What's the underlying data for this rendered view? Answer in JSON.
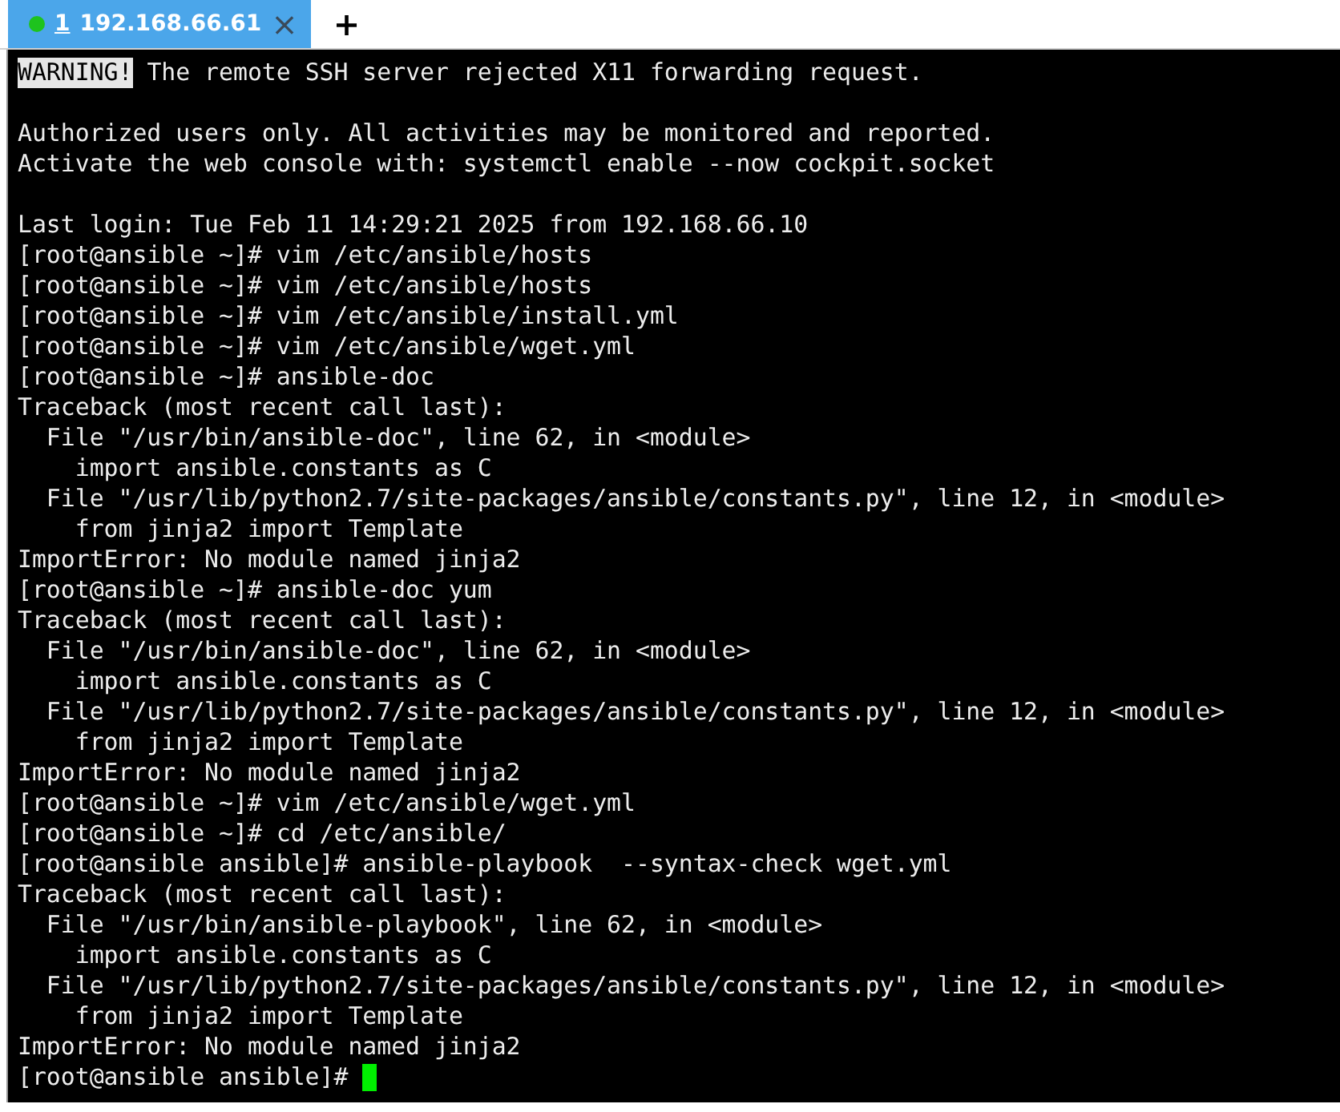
{
  "tabs": [
    {
      "index": "1",
      "title": "192.168.66.61",
      "close": "×",
      "selected": true,
      "color": "#1ec31e"
    }
  ],
  "new_tab": "+",
  "lines": [
    {
      "kind": "text",
      "badge": "WARNING!",
      "text": " The remote SSH server rejected X11 forwarding request."
    },
    {
      "kind": "blank"
    },
    {
      "kind": "text",
      "text": "Authorized users only. All activities may be monitored and reported."
    },
    {
      "kind": "text",
      "text": "Activate the web console with: systemctl enable --now cockpit.socket"
    },
    {
      "kind": "blank"
    },
    {
      "kind": "text",
      "text": "Last login: Tue Feb 11 14:29:21 2025 from 192.168.66.10"
    },
    {
      "kind": "text",
      "text": "[root@ansible ~]# vim /etc/ansible/hosts"
    },
    {
      "kind": "text",
      "text": "[root@ansible ~]# vim /etc/ansible/hosts"
    },
    {
      "kind": "text",
      "text": "[root@ansible ~]# vim /etc/ansible/install.yml"
    },
    {
      "kind": "text",
      "text": "[root@ansible ~]# vim /etc/ansible/wget.yml"
    },
    {
      "kind": "text",
      "text": "[root@ansible ~]# ansible-doc"
    },
    {
      "kind": "text",
      "text": "Traceback (most recent call last):"
    },
    {
      "kind": "text",
      "text": "  File \"/usr/bin/ansible-doc\", line 62, in <module>"
    },
    {
      "kind": "text",
      "text": "    import ansible.constants as C"
    },
    {
      "kind": "text",
      "text": "  File \"/usr/lib/python2.7/site-packages/ansible/constants.py\", line 12, in <module>"
    },
    {
      "kind": "text",
      "text": "    from jinja2 import Template"
    },
    {
      "kind": "text",
      "text": "ImportError: No module named jinja2"
    },
    {
      "kind": "text",
      "text": "[root@ansible ~]# ansible-doc yum"
    },
    {
      "kind": "text",
      "text": "Traceback (most recent call last):"
    },
    {
      "kind": "text",
      "text": "  File \"/usr/bin/ansible-doc\", line 62, in <module>"
    },
    {
      "kind": "text",
      "text": "    import ansible.constants as C"
    },
    {
      "kind": "text",
      "text": "  File \"/usr/lib/python2.7/site-packages/ansible/constants.py\", line 12, in <module>"
    },
    {
      "kind": "text",
      "text": "    from jinja2 import Template"
    },
    {
      "kind": "text",
      "text": "ImportError: No module named jinja2"
    },
    {
      "kind": "text",
      "text": "[root@ansible ~]# vim /etc/ansible/wget.yml"
    },
    {
      "kind": "text",
      "text": "[root@ansible ~]# cd /etc/ansible/"
    },
    {
      "kind": "text",
      "text": "[root@ansible ansible]# ansible-playbook  --syntax-check wget.yml"
    },
    {
      "kind": "text",
      "text": "Traceback (most recent call last):"
    },
    {
      "kind": "text",
      "text": "  File \"/usr/bin/ansible-playbook\", line 62, in <module>"
    },
    {
      "kind": "text",
      "text": "    import ansible.constants as C"
    },
    {
      "kind": "text",
      "text": "  File \"/usr/lib/python2.7/site-packages/ansible/constants.py\", line 12, in <module>"
    },
    {
      "kind": "text",
      "text": "    from jinja2 import Template"
    },
    {
      "kind": "text",
      "text": "ImportError: No module named jinja2"
    },
    {
      "kind": "text",
      "text": "[root@ansible ansible]# ",
      "cursor": true
    }
  ]
}
